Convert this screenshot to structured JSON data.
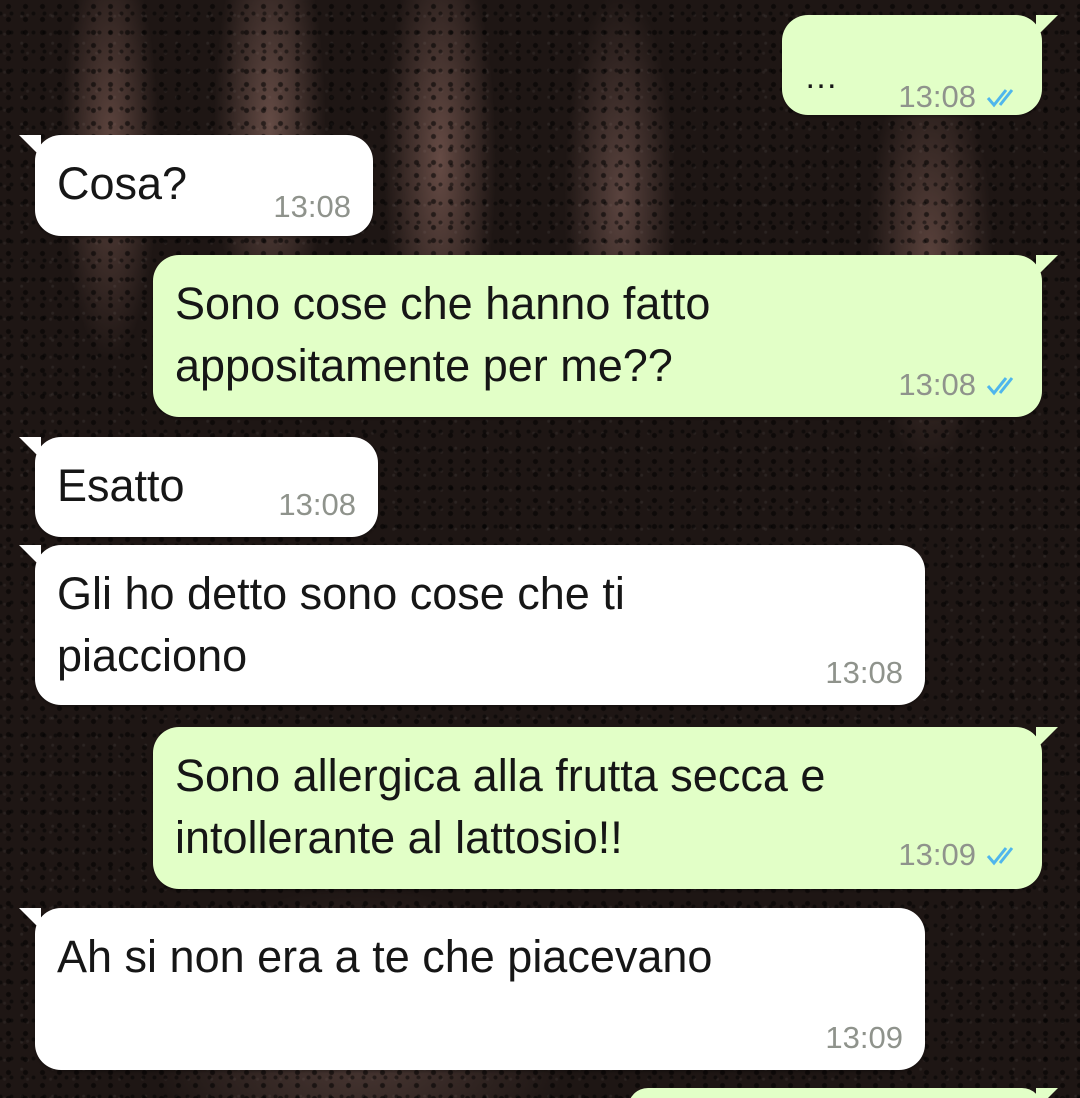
{
  "chat": {
    "messages": [
      {
        "direction": "out",
        "text": "…",
        "time": "13:08",
        "status": "read"
      },
      {
        "direction": "in",
        "text": "Cosa?",
        "time": "13:08"
      },
      {
        "direction": "out",
        "text": "Sono cose che hanno fatto\nappositamente per me??",
        "time": "13:08",
        "status": "read"
      },
      {
        "direction": "in",
        "text": "Esatto",
        "time": "13:08"
      },
      {
        "direction": "in",
        "text": "Gli ho detto sono cose che ti\npiacciono",
        "time": "13:08"
      },
      {
        "direction": "out",
        "text": "Sono allergica alla frutta secca e\nintollerante al lattosio!!",
        "time": "13:09",
        "status": "read"
      },
      {
        "direction": "in",
        "text": "Ah si non era a te che piacevano",
        "time": "13:09"
      }
    ]
  },
  "colors": {
    "outgoing_bubble": "#e2ffc7",
    "incoming_bubble": "#ffffff",
    "read_ticks": "#4fb6ec",
    "timestamp": "#8f938c"
  },
  "icons": {
    "read_receipt": "double-check-icon"
  }
}
